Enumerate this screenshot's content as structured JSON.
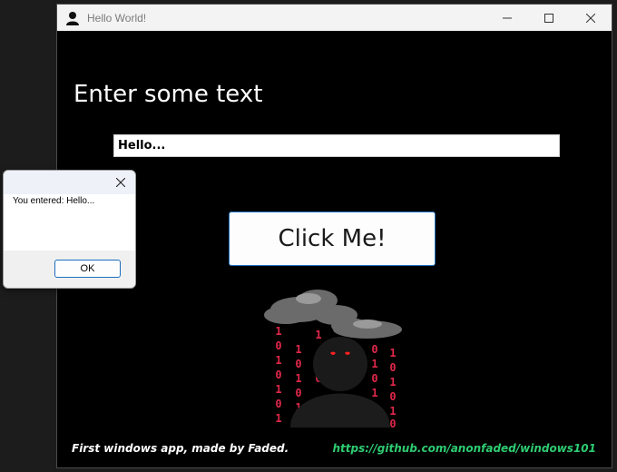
{
  "window": {
    "title": "Hello World!",
    "title_icon": "user-silhouette-icon",
    "controls": [
      "minimize-icon",
      "maximize-icon",
      "close-icon"
    ]
  },
  "main": {
    "heading": "Enter some text",
    "input_value": "Hello...",
    "button_label": "Click Me!",
    "artwork_icon": "hooded-figure-binary-rain-image"
  },
  "footer": {
    "left_text": "First windows app, made by Faded.",
    "right_text": "https://github.com/anonfaded/windows101",
    "right_color": "#2ecc71"
  },
  "dialog": {
    "message": "You entered: Hello...",
    "ok_label": "OK"
  },
  "colors": {
    "window_background": "#000000",
    "accent_border": "#1b6fbe",
    "binary_digits": "#e0284a"
  }
}
